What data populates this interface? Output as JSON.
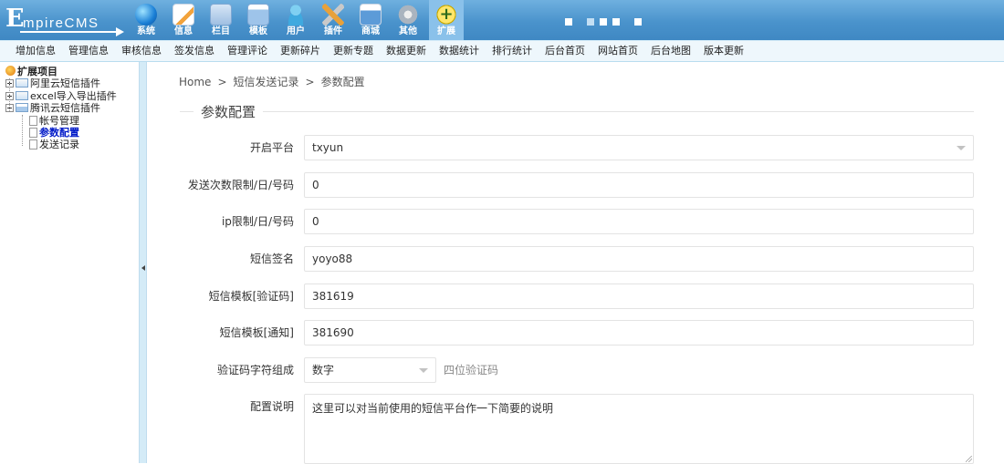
{
  "header": {
    "logo_text": "EmpireCMS",
    "nav": [
      {
        "label": "系统",
        "icon": "globe-icon"
      },
      {
        "label": "信息",
        "icon": "edit-document-icon"
      },
      {
        "label": "栏目",
        "icon": "folder-icon"
      },
      {
        "label": "模板",
        "icon": "template-window-icon"
      },
      {
        "label": "用户",
        "icon": "user-icon"
      },
      {
        "label": "插件",
        "icon": "tools-icon"
      },
      {
        "label": "商城",
        "icon": "shop-card-icon"
      },
      {
        "label": "其他",
        "icon": "gear-icon"
      },
      {
        "label": "扩展",
        "icon": "plus-circle-icon",
        "active": true
      }
    ]
  },
  "submenu": [
    "增加信息",
    "管理信息",
    "审核信息",
    "签发信息",
    "管理评论",
    "更新碎片",
    "更新专题",
    "数据更新",
    "数据统计",
    "排行统计",
    "后台首页",
    "网站首页",
    "后台地图",
    "版本更新"
  ],
  "tree": {
    "root": "扩展项目",
    "nodes": [
      {
        "label": "阿里云短信插件",
        "expanded": false
      },
      {
        "label": "excel导入导出插件",
        "expanded": false
      },
      {
        "label": "腾讯云短信插件",
        "expanded": true,
        "children": [
          {
            "label": "帐号管理",
            "current": false
          },
          {
            "label": "参数配置",
            "current": true
          },
          {
            "label": "发送记录",
            "current": false
          }
        ]
      }
    ]
  },
  "breadcrumb": {
    "home": "Home",
    "sep": ">",
    "level1": "短信发送记录",
    "level2": "参数配置"
  },
  "section_title": "参数配置",
  "form": {
    "platform": {
      "label": "开启平台",
      "value": "txyun"
    },
    "send_limit": {
      "label": "发送次数限制/日/号码",
      "value": "0"
    },
    "ip_limit": {
      "label": "ip限制/日/号码",
      "value": "0"
    },
    "signature": {
      "label": "短信签名",
      "value": "yoyo88"
    },
    "tpl_verify": {
      "label": "短信模板[验证码]",
      "value": "381619"
    },
    "tpl_notice": {
      "label": "短信模板[通知]",
      "value": "381690"
    },
    "code_chars": {
      "label": "验证码字符组成",
      "value": "数字",
      "hint": "四位验证码"
    },
    "description": {
      "label": "配置说明",
      "value": "这里可以对当前使用的短信平台作一下简要的说明"
    }
  }
}
